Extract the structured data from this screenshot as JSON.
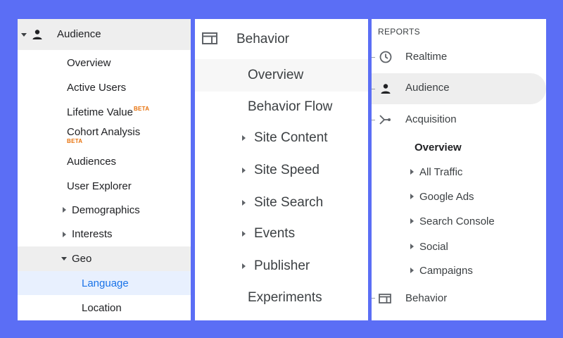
{
  "panel1": {
    "header": "Audience",
    "items": {
      "overview": "Overview",
      "active_users": "Active Users",
      "lifetime_value": "Lifetime Value",
      "lifetime_value_badge": "BETA",
      "cohort_analysis": "Cohort Analysis",
      "cohort_analysis_badge": "BETA",
      "audiences": "Audiences",
      "user_explorer": "User Explorer",
      "demographics": "Demographics",
      "interests": "Interests",
      "geo": "Geo",
      "language": "Language",
      "location": "Location"
    }
  },
  "panel2": {
    "header": "Behavior",
    "items": {
      "overview": "Overview",
      "behavior_flow": "Behavior Flow",
      "site_content": "Site Content",
      "site_speed": "Site Speed",
      "site_search": "Site Search",
      "events": "Events",
      "publisher": "Publisher",
      "experiments": "Experiments"
    }
  },
  "panel3": {
    "section_label": "REPORTS",
    "items": {
      "realtime": "Realtime",
      "audience": "Audience",
      "acquisition": "Acquisition",
      "acq_overview": "Overview",
      "all_traffic": "All Traffic",
      "google_ads": "Google Ads",
      "search_console": "Search Console",
      "social": "Social",
      "campaigns": "Campaigns",
      "behavior": "Behavior"
    }
  },
  "colors": {
    "background": "#5b6ef5",
    "beta": "#e8710a",
    "link_active": "#1a73e8",
    "highlight": "#eeeeee",
    "selected": "#e8f0fe"
  },
  "icons": [
    "person-icon",
    "caret-down-icon",
    "caret-right-icon",
    "behavior-icon",
    "clock-icon",
    "acquisition-icon"
  ]
}
